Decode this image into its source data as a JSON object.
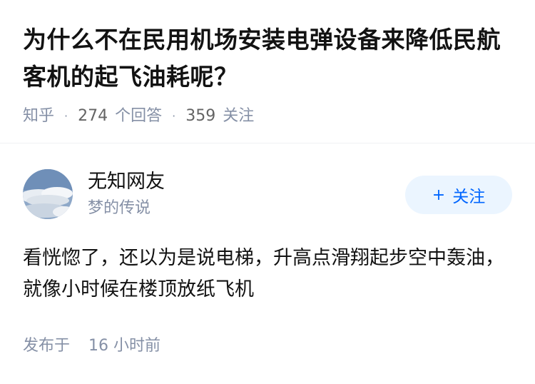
{
  "question": {
    "title": "为什么不在民用机场安装电弹设备来降低民航客机的起飞油耗呢？",
    "source": "知乎",
    "answer_count": "274",
    "answer_label": "个回答",
    "follower_count": "359",
    "follower_label": "关注"
  },
  "author": {
    "name": "无知网友",
    "bio": "梦的传说",
    "follow_icon": "+",
    "follow_label": "关注",
    "avatar_icon": "sky-cloud-avatar"
  },
  "answer": {
    "content": "看恍惚了，还以为是说电梯，升高点滑翔起步空中轰油，就像小时候在楼顶放纸飞机",
    "time_prefix": "发布于",
    "time_value": "16 小时前"
  },
  "colors": {
    "accent": "#0066ff",
    "follow_bg": "#ebf5ff",
    "meta": "#8590a6",
    "text": "#121212"
  }
}
